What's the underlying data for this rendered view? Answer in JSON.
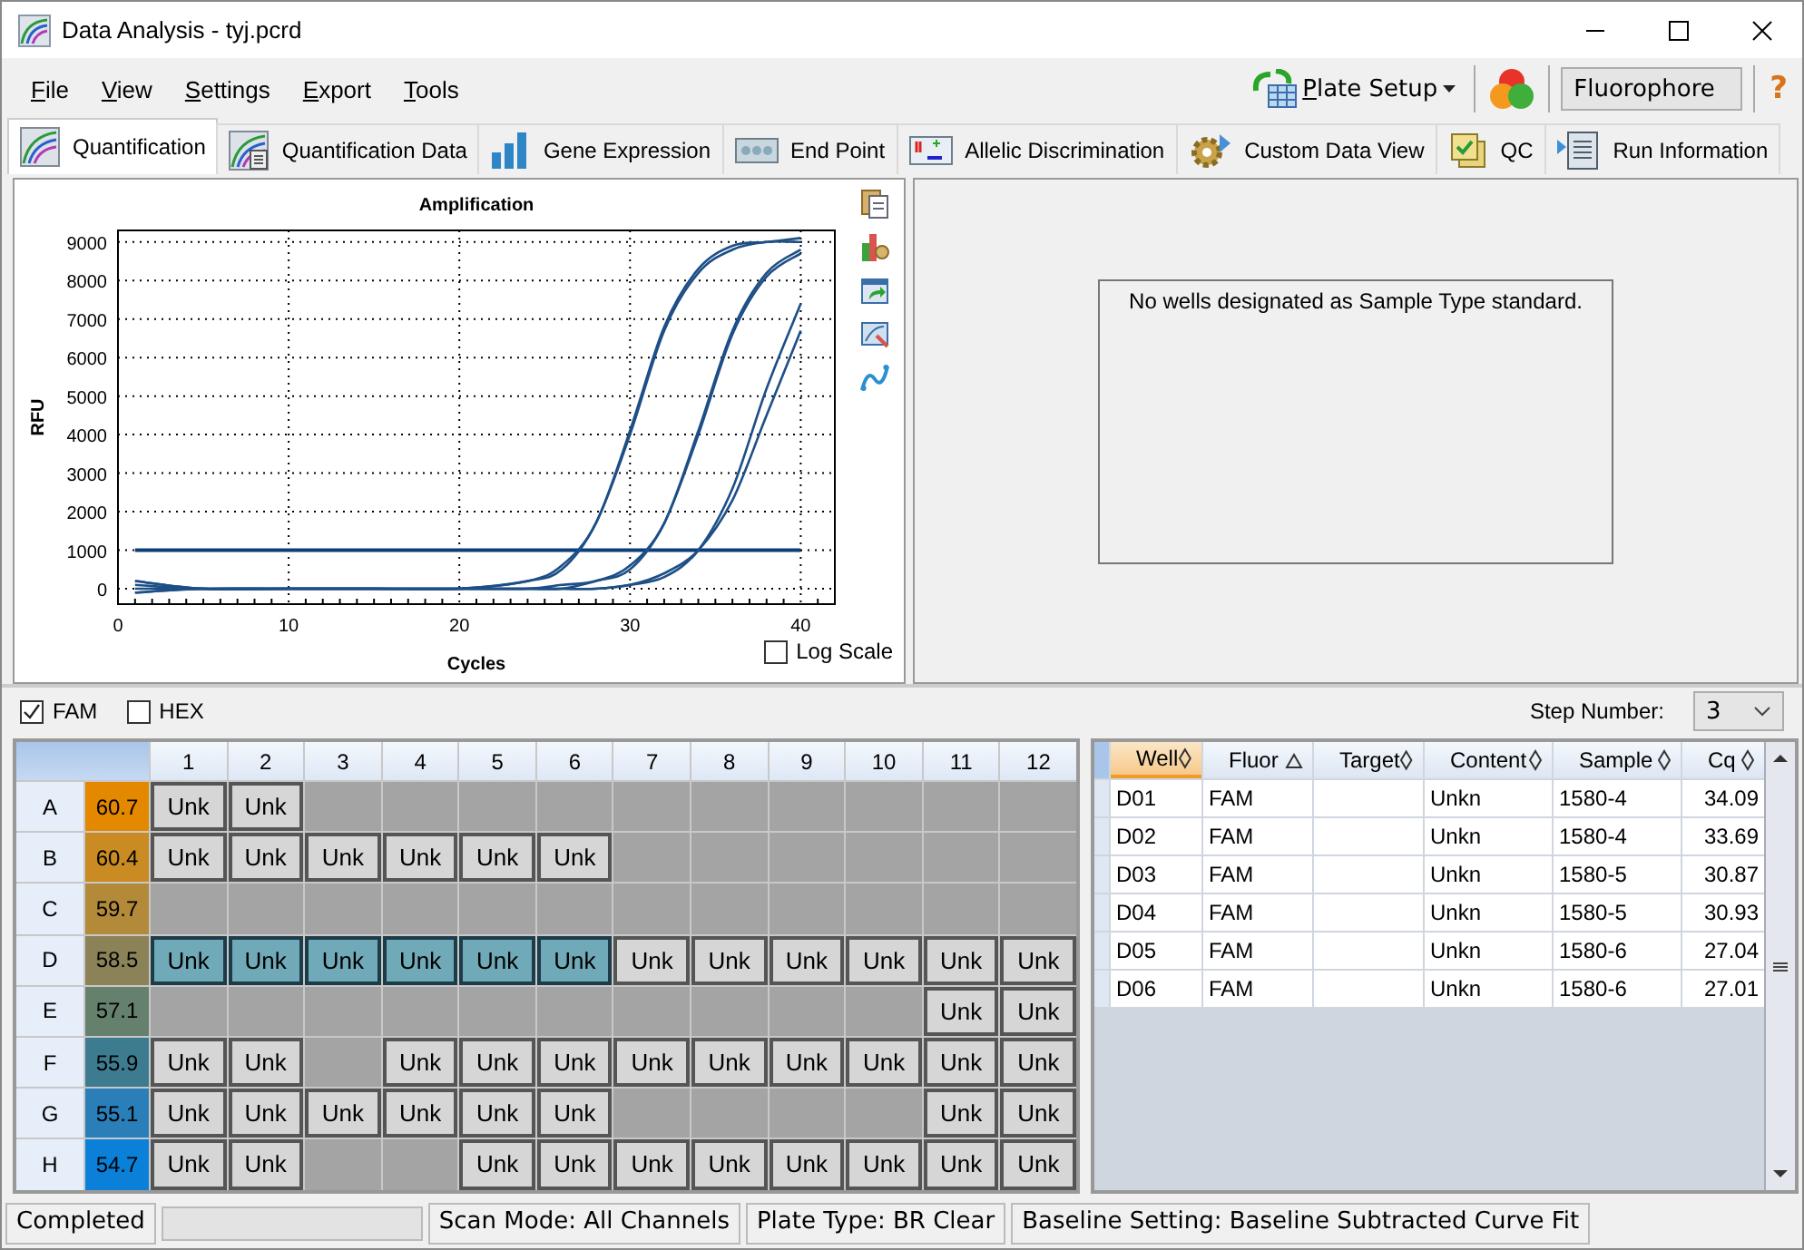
{
  "window": {
    "title": "Data Analysis - tyj.pcrd"
  },
  "menu": [
    "File",
    "View",
    "Settings",
    "Export",
    "Tools"
  ],
  "toolbar": {
    "plate_setup": "Plate Setup",
    "fluorophore_select": "Fluorophore",
    "help": "?"
  },
  "tabs": [
    {
      "label": "Quantification",
      "selected": true,
      "kind": "curve"
    },
    {
      "label": "Quantification Data",
      "selected": false,
      "kind": "data"
    },
    {
      "label": "Gene Expression",
      "selected": false,
      "kind": "bars"
    },
    {
      "label": "End Point",
      "selected": false,
      "kind": "dots"
    },
    {
      "label": "Allelic Discrimination",
      "selected": false,
      "kind": "scatter"
    },
    {
      "label": "Custom Data View",
      "selected": false,
      "kind": "gear"
    },
    {
      "label": "QC",
      "selected": false,
      "kind": "check"
    },
    {
      "label": "Run Information",
      "selected": false,
      "kind": "doc"
    }
  ],
  "amplification": {
    "log_scale": {
      "label": "Log Scale",
      "checked": false
    },
    "chart_data": {
      "type": "line",
      "title": "Amplification",
      "xlabel": "Cycles",
      "ylabel": "RFU",
      "x": [
        1,
        5,
        10,
        15,
        20,
        24,
        26,
        28,
        30,
        32,
        34,
        36,
        38,
        40
      ],
      "series": [
        {
          "color": "#1d4f86",
          "values": [
            200,
            0,
            0,
            0,
            0,
            200,
            600,
            1700,
            4100,
            6800,
            8300,
            8900,
            9000,
            9100
          ]
        },
        {
          "color": "#1d4f86",
          "values": [
            100,
            0,
            0,
            0,
            0,
            200,
            500,
            1700,
            4000,
            6700,
            8200,
            8800,
            9000,
            9000
          ]
        },
        {
          "color": "#1d4f86",
          "values": [
            0,
            0,
            0,
            0,
            0,
            0,
            100,
            200,
            600,
            1700,
            4100,
            6700,
            8200,
            8800
          ]
        },
        {
          "color": "#1d4f86",
          "values": [
            -100,
            0,
            0,
            0,
            0,
            0,
            0,
            200,
            500,
            1700,
            4000,
            6600,
            8100,
            8700
          ]
        },
        {
          "color": "#1d4f86",
          "values": [
            200,
            0,
            0,
            0,
            0,
            0,
            0,
            0,
            100,
            400,
            1000,
            2300,
            4500,
            6700
          ]
        },
        {
          "color": "#1d4f86",
          "values": [
            -100,
            0,
            0,
            0,
            0,
            0,
            0,
            0,
            100,
            300,
            1000,
            2600,
            5200,
            7400
          ]
        }
      ],
      "xlim": [
        0,
        42
      ],
      "ylim": [
        -400,
        9300
      ],
      "xticks": [
        0,
        10,
        20,
        30,
        40
      ],
      "yticks": [
        0,
        1000,
        2000,
        3000,
        4000,
        5000,
        6000,
        7000,
        8000,
        9000
      ],
      "grid": true,
      "ref_lines": [
        {
          "axis": "y",
          "value": 1000
        }
      ]
    }
  },
  "standard_curve": {
    "message": "No wells designated as Sample Type standard."
  },
  "channels": [
    {
      "label": "FAM",
      "checked": true
    },
    {
      "label": "HEX",
      "checked": false
    }
  ],
  "step_number": {
    "label": "Step Number:",
    "value": "3"
  },
  "plate": {
    "columns": [
      "1",
      "2",
      "3",
      "4",
      "5",
      "6",
      "7",
      "8",
      "9",
      "10",
      "11",
      "12"
    ],
    "rows": [
      {
        "label": "A",
        "temp": "60.7",
        "color": "#e48800",
        "wells": [
          {
            "kind": "sample",
            "label": "Unk",
            "selected": false
          },
          {
            "kind": "sample",
            "label": "Unk",
            "selected": false
          },
          {
            "kind": "empty"
          },
          {
            "kind": "empty"
          },
          {
            "kind": "empty"
          },
          {
            "kind": "empty"
          },
          {
            "kind": "empty"
          },
          {
            "kind": "empty"
          },
          {
            "kind": "empty"
          },
          {
            "kind": "empty"
          },
          {
            "kind": "empty"
          },
          {
            "kind": "empty"
          }
        ]
      },
      {
        "label": "B",
        "temp": "60.4",
        "color": "#c98b22",
        "wells": [
          {
            "kind": "sample",
            "label": "Unk",
            "selected": false
          },
          {
            "kind": "sample",
            "label": "Unk",
            "selected": false
          },
          {
            "kind": "sample",
            "label": "Unk",
            "selected": false
          },
          {
            "kind": "sample",
            "label": "Unk",
            "selected": false
          },
          {
            "kind": "sample",
            "label": "Unk",
            "selected": false
          },
          {
            "kind": "sample",
            "label": "Unk",
            "selected": false
          },
          {
            "kind": "empty"
          },
          {
            "kind": "empty"
          },
          {
            "kind": "empty"
          },
          {
            "kind": "empty"
          },
          {
            "kind": "empty"
          },
          {
            "kind": "empty"
          }
        ]
      },
      {
        "label": "C",
        "temp": "59.7",
        "color": "#b38a3a",
        "wells": [
          {
            "kind": "empty"
          },
          {
            "kind": "empty"
          },
          {
            "kind": "empty"
          },
          {
            "kind": "empty"
          },
          {
            "kind": "empty"
          },
          {
            "kind": "empty"
          },
          {
            "kind": "empty"
          },
          {
            "kind": "empty"
          },
          {
            "kind": "empty"
          },
          {
            "kind": "empty"
          },
          {
            "kind": "empty"
          },
          {
            "kind": "empty"
          }
        ]
      },
      {
        "label": "D",
        "temp": "58.5",
        "color": "#8c8258",
        "wells": [
          {
            "kind": "sample",
            "label": "Unk",
            "selected": true
          },
          {
            "kind": "sample",
            "label": "Unk",
            "selected": true
          },
          {
            "kind": "sample",
            "label": "Unk",
            "selected": true
          },
          {
            "kind": "sample",
            "label": "Unk",
            "selected": true
          },
          {
            "kind": "sample",
            "label": "Unk",
            "selected": true
          },
          {
            "kind": "sample",
            "label": "Unk",
            "selected": true
          },
          {
            "kind": "sample",
            "label": "Unk",
            "selected": false
          },
          {
            "kind": "sample",
            "label": "Unk",
            "selected": false
          },
          {
            "kind": "sample",
            "label": "Unk",
            "selected": false
          },
          {
            "kind": "sample",
            "label": "Unk",
            "selected": false
          },
          {
            "kind": "sample",
            "label": "Unk",
            "selected": false
          },
          {
            "kind": "sample",
            "label": "Unk",
            "selected": false
          }
        ]
      },
      {
        "label": "E",
        "temp": "57.1",
        "color": "#66806e",
        "wells": [
          {
            "kind": "empty"
          },
          {
            "kind": "empty"
          },
          {
            "kind": "empty"
          },
          {
            "kind": "empty"
          },
          {
            "kind": "empty"
          },
          {
            "kind": "empty"
          },
          {
            "kind": "empty"
          },
          {
            "kind": "empty"
          },
          {
            "kind": "empty"
          },
          {
            "kind": "empty"
          },
          {
            "kind": "sample",
            "label": "Unk",
            "selected": false
          },
          {
            "kind": "sample",
            "label": "Unk",
            "selected": false
          }
        ]
      },
      {
        "label": "F",
        "temp": "55.9",
        "color": "#3d7c90",
        "wells": [
          {
            "kind": "sample",
            "label": "Unk",
            "selected": false
          },
          {
            "kind": "sample",
            "label": "Unk",
            "selected": false
          },
          {
            "kind": "empty"
          },
          {
            "kind": "sample",
            "label": "Unk",
            "selected": false
          },
          {
            "kind": "sample",
            "label": "Unk",
            "selected": false
          },
          {
            "kind": "sample",
            "label": "Unk",
            "selected": false
          },
          {
            "kind": "sample",
            "label": "Unk",
            "selected": false
          },
          {
            "kind": "sample",
            "label": "Unk",
            "selected": false
          },
          {
            "kind": "sample",
            "label": "Unk",
            "selected": false
          },
          {
            "kind": "sample",
            "label": "Unk",
            "selected": false
          },
          {
            "kind": "sample",
            "label": "Unk",
            "selected": false
          },
          {
            "kind": "sample",
            "label": "Unk",
            "selected": false
          }
        ]
      },
      {
        "label": "G",
        "temp": "55.1",
        "color": "#2a7fb8",
        "wells": [
          {
            "kind": "sample",
            "label": "Unk",
            "selected": false
          },
          {
            "kind": "sample",
            "label": "Unk",
            "selected": false
          },
          {
            "kind": "sample",
            "label": "Unk",
            "selected": false
          },
          {
            "kind": "sample",
            "label": "Unk",
            "selected": false
          },
          {
            "kind": "sample",
            "label": "Unk",
            "selected": false
          },
          {
            "kind": "sample",
            "label": "Unk",
            "selected": false
          },
          {
            "kind": "empty"
          },
          {
            "kind": "empty"
          },
          {
            "kind": "empty"
          },
          {
            "kind": "empty"
          },
          {
            "kind": "sample",
            "label": "Unk",
            "selected": false
          },
          {
            "kind": "sample",
            "label": "Unk",
            "selected": false
          }
        ]
      },
      {
        "label": "H",
        "temp": "54.7",
        "color": "#0a80d8",
        "wells": [
          {
            "kind": "sample",
            "label": "Unk",
            "selected": false
          },
          {
            "kind": "sample",
            "label": "Unk",
            "selected": false
          },
          {
            "kind": "empty"
          },
          {
            "kind": "empty"
          },
          {
            "kind": "sample",
            "label": "Unk",
            "selected": false
          },
          {
            "kind": "sample",
            "label": "Unk",
            "selected": false
          },
          {
            "kind": "sample",
            "label": "Unk",
            "selected": false
          },
          {
            "kind": "sample",
            "label": "Unk",
            "selected": false
          },
          {
            "kind": "sample",
            "label": "Unk",
            "selected": false
          },
          {
            "kind": "sample",
            "label": "Unk",
            "selected": false
          },
          {
            "kind": "sample",
            "label": "Unk",
            "selected": false
          },
          {
            "kind": "sample",
            "label": "Unk",
            "selected": false
          }
        ]
      }
    ]
  },
  "results_table": {
    "columns": [
      {
        "label": "Well",
        "selected": true,
        "sorted": false
      },
      {
        "label": "Fluor",
        "selected": false,
        "sorted": true
      },
      {
        "label": "Target",
        "selected": false,
        "sorted": false
      },
      {
        "label": "Content",
        "selected": false,
        "sorted": false
      },
      {
        "label": "Sample",
        "selected": false,
        "sorted": false
      },
      {
        "label": "Cq",
        "selected": false,
        "sorted": false
      }
    ],
    "rows": [
      [
        "D01",
        "FAM",
        "",
        "Unkn",
        "1580-4",
        "34.09"
      ],
      [
        "D02",
        "FAM",
        "",
        "Unkn",
        "1580-4",
        "33.69"
      ],
      [
        "D03",
        "FAM",
        "",
        "Unkn",
        "1580-5",
        "30.87"
      ],
      [
        "D04",
        "FAM",
        "",
        "Unkn",
        "1580-5",
        "30.93"
      ],
      [
        "D05",
        "FAM",
        "",
        "Unkn",
        "1580-6",
        "27.04"
      ],
      [
        "D06",
        "FAM",
        "",
        "Unkn",
        "1580-6",
        "27.01"
      ]
    ]
  },
  "status_bar": {
    "status": "Completed",
    "progress": {
      "level": 0
    },
    "scan_mode": "Scan Mode: All Channels",
    "plate_type": "Plate Type: BR Clear",
    "baseline": "Baseline Setting: Baseline Subtracted Curve Fit"
  }
}
